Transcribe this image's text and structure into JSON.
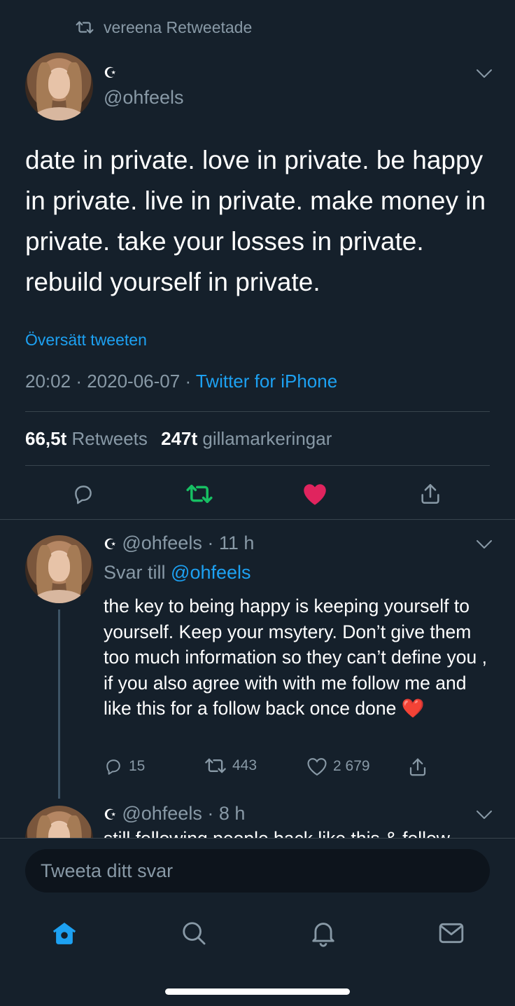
{
  "retweet_header": {
    "text": "vereena Retweetade"
  },
  "main_tweet": {
    "display_name": "☪︎",
    "handle": "@ohfeels",
    "body": "date in private. love in private. be happy in private. live in private. make money in private. take your losses in private. rebuild yourself in private.",
    "translate_label": "Översätt tweeten",
    "time": "20:02",
    "date": "2020-06-07",
    "source": "Twitter for iPhone",
    "retweets_count": "66,5t",
    "retweets_label": "Retweets",
    "likes_count": "247t",
    "likes_label": "gillamarkeringar"
  },
  "replies": [
    {
      "display_name": "☪︎",
      "handle": "@ohfeels",
      "time": "11 h",
      "reply_to_prefix": "Svar till",
      "reply_to_handle": "@ohfeels",
      "body": "the key to being happy  is keeping yourself to yourself. Keep your msytery. Don’t give them too much information so they can’t define you , if you also agree with with me follow me and like this for a follow back once done ❤️",
      "reply_count": "15",
      "retweet_count": "443",
      "like_count": "2 679"
    },
    {
      "display_name": "☪︎",
      "handle": "@ohfeels",
      "time": "8 h",
      "body_partial": "still following people back like this & follow"
    }
  ],
  "compose": {
    "placeholder": "Tweeta ditt svar"
  },
  "tabbar": {
    "items": [
      "home-icon",
      "search-icon",
      "notifications-icon",
      "messages-icon"
    ]
  },
  "colors": {
    "background": "#15202b",
    "accent": "#1da1f2",
    "retweet": "#17bf63",
    "like": "#e0245e",
    "muted": "#8899a6"
  }
}
